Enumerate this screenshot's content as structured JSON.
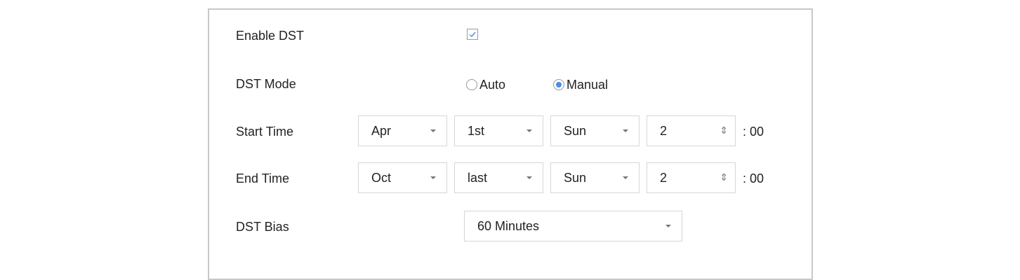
{
  "rows": {
    "enable_dst": {
      "label": "Enable DST",
      "checked": true
    },
    "dst_mode": {
      "label": "DST Mode",
      "options": [
        "Auto",
        "Manual"
      ],
      "selected": "Manual"
    },
    "start_time": {
      "label": "Start Time",
      "month": "Apr",
      "week": "1st",
      "day": "Sun",
      "hour": "2",
      "suffix": ": 00"
    },
    "end_time": {
      "label": "End Time",
      "month": "Oct",
      "week": "last",
      "day": "Sun",
      "hour": "2",
      "suffix": ": 00"
    },
    "dst_bias": {
      "label": "DST Bias",
      "value": "60 Minutes"
    }
  },
  "colors": {
    "accent": "#4a8fe0",
    "border": "#c8c8c8"
  },
  "icons": {
    "checkbox": "checkmark-icon",
    "dropdown": "caret-down-icon",
    "spinner": "spinner-icon"
  },
  "spinner_glyph": "⇕"
}
